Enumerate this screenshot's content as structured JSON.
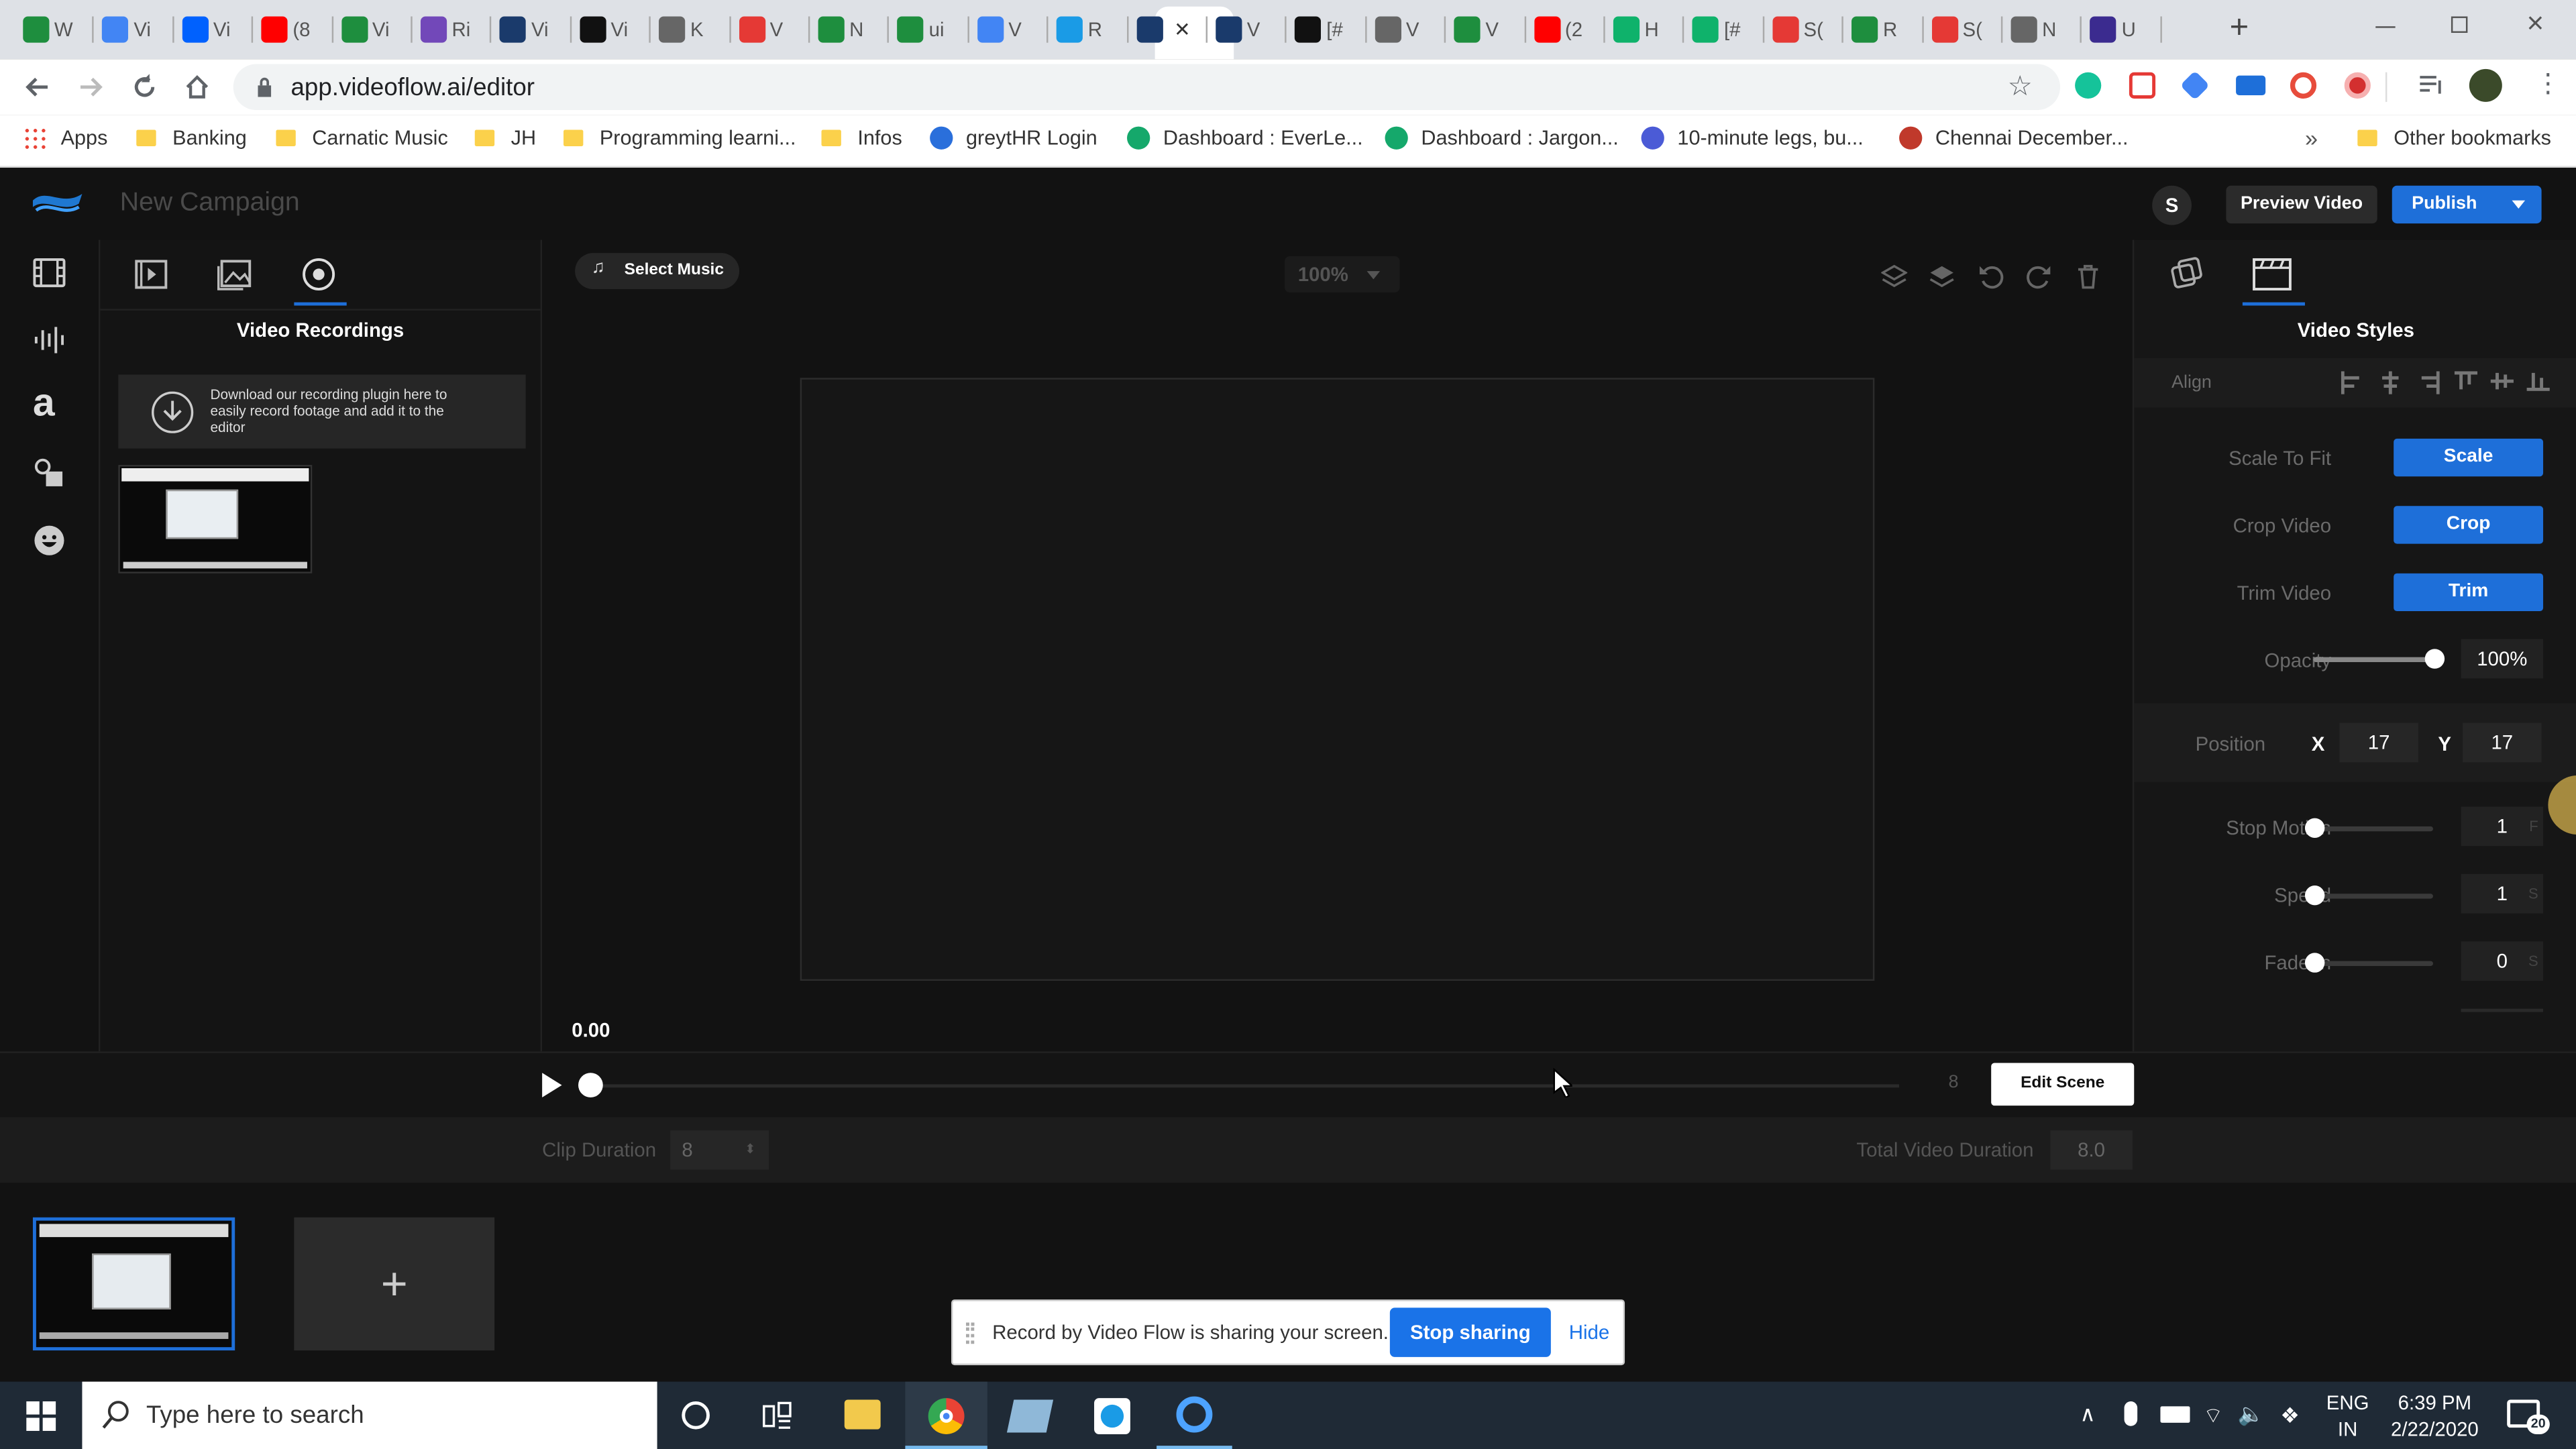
{
  "browser": {
    "tabs": [
      {
        "icon": "sheets-icon",
        "letter": "W",
        "color": "#1e8e3e"
      },
      {
        "icon": "docs-icon",
        "letter": "Vi",
        "color": "#4285f4"
      },
      {
        "icon": "dropbox-icon",
        "letter": "Vi",
        "color": "#0061fe"
      },
      {
        "icon": "youtube-icon",
        "letter": "(8",
        "color": "#ff0000"
      },
      {
        "icon": "sheets-icon",
        "letter": "Vi",
        "color": "#1e8e3e"
      },
      {
        "icon": "forms-icon",
        "letter": "Ri",
        "color": "#7248b9"
      },
      {
        "icon": "videoflow-icon",
        "letter": "Vi",
        "color": "#1a3a6b"
      },
      {
        "icon": "app-icon",
        "letter": "Vi",
        "color": "#111111"
      },
      {
        "icon": "globe-icon",
        "letter": "K",
        "color": "#666666"
      },
      {
        "icon": "zoho-icon",
        "letter": "V",
        "color": "#e53935"
      },
      {
        "icon": "sheets-icon",
        "letter": "N",
        "color": "#1e8e3e"
      },
      {
        "icon": "sheets-icon",
        "letter": "ui",
        "color": "#1e8e3e"
      },
      {
        "icon": "docs-icon",
        "letter": "V",
        "color": "#4285f4"
      },
      {
        "icon": "app-icon",
        "letter": "R",
        "color": "#1a9be6"
      },
      {
        "icon": "videoflow-icon",
        "letter": "",
        "color": "#1a3a6b"
      },
      {
        "icon": "videoflow-icon",
        "letter": "V",
        "color": "#1a3a6b"
      },
      {
        "icon": "app-icon",
        "letter": "[#",
        "color": "#111111"
      },
      {
        "icon": "globe-icon",
        "letter": "V",
        "color": "#666666"
      },
      {
        "icon": "sheets-icon",
        "letter": "V",
        "color": "#1e8e3e"
      },
      {
        "icon": "youtube-icon",
        "letter": "(2",
        "color": "#ff0000"
      },
      {
        "icon": "app-icon",
        "letter": "H",
        "color": "#0fb26b"
      },
      {
        "icon": "app-icon",
        "letter": "[#",
        "color": "#0fb26b"
      },
      {
        "icon": "zoho-icon",
        "letter": "S(",
        "color": "#e53935"
      },
      {
        "icon": "sheets-icon",
        "letter": "R",
        "color": "#1e8e3e"
      },
      {
        "icon": "zoho-icon",
        "letter": "S(",
        "color": "#e53935"
      },
      {
        "icon": "globe-icon",
        "letter": "N",
        "color": "#666666"
      },
      {
        "icon": "videoflow-icon",
        "letter": "U",
        "color": "#3b2b8f"
      }
    ],
    "url": "app.videoflow.ai/editor",
    "bookmarks": [
      {
        "label": "Apps",
        "kind": "apps"
      },
      {
        "label": "Banking",
        "kind": "folder"
      },
      {
        "label": "Carnatic Music",
        "kind": "folder"
      },
      {
        "label": "JH",
        "kind": "folder"
      },
      {
        "label": "Programming learni...",
        "kind": "folder"
      },
      {
        "label": "Infos",
        "kind": "folder"
      },
      {
        "label": "greytHR Login",
        "kind": "site"
      },
      {
        "label": "Dashboard : EverLe...",
        "kind": "site"
      },
      {
        "label": "Dashboard : Jargon...",
        "kind": "site"
      },
      {
        "label": "10-minute legs, bu...",
        "kind": "site"
      },
      {
        "label": "Chennai December...",
        "kind": "site"
      }
    ],
    "other_bookmarks": "Other bookmarks",
    "overflow": "»"
  },
  "app": {
    "title": "New Campaign",
    "avatar_letter": "S",
    "preview_label": "Preview Video",
    "publish_label": "Publish",
    "select_music": "Select Music",
    "zoom": "100%",
    "left_panel_title": "Video Recordings",
    "plugin_notice": "Download our recording plugin here to easily record footage and add it to the editor",
    "right_panel_title": "Video Styles",
    "align_label": "Align",
    "scale_label": "Scale To Fit",
    "scale_btn": "Scale",
    "crop_label": "Crop Video",
    "crop_btn": "Crop",
    "trim_label": "Trim Video",
    "trim_btn": "Trim",
    "opacity_label": "Opacity",
    "opacity_value": "100%",
    "opacity_level": 1.0,
    "position_label": "Position",
    "x_label": "X",
    "x_value": "17",
    "y_label": "Y",
    "y_value": "17",
    "stop_motion_label": "Stop Motion",
    "stop_motion_value": "1",
    "stop_motion_unit": "F",
    "speed_label": "Speed",
    "speed_value": "1",
    "speed_unit": "S",
    "fade_in_label": "Fade In",
    "fade_in_value": "0",
    "fade_in_unit": "S",
    "current_time": "0.00",
    "end_time": "8",
    "edit_scene": "Edit Scene",
    "clip_duration_label": "Clip Duration",
    "clip_duration_value": "8",
    "total_duration_label": "Total Video Duration",
    "total_duration_value": "8.0",
    "add_scene": "+"
  },
  "share_bar": {
    "message": "Record by Video Flow is sharing your screen.",
    "stop_label": "Stop sharing",
    "hide_label": "Hide"
  },
  "taskbar": {
    "search_placeholder": "Type here to search",
    "lang_top": "ENG",
    "lang_bottom": "IN",
    "time": "6:39 PM",
    "date": "2/22/2020",
    "notifications": "20"
  },
  "colors": {
    "accent": "#1e6fd9",
    "bg": "#121212",
    "panel": "#161616"
  }
}
